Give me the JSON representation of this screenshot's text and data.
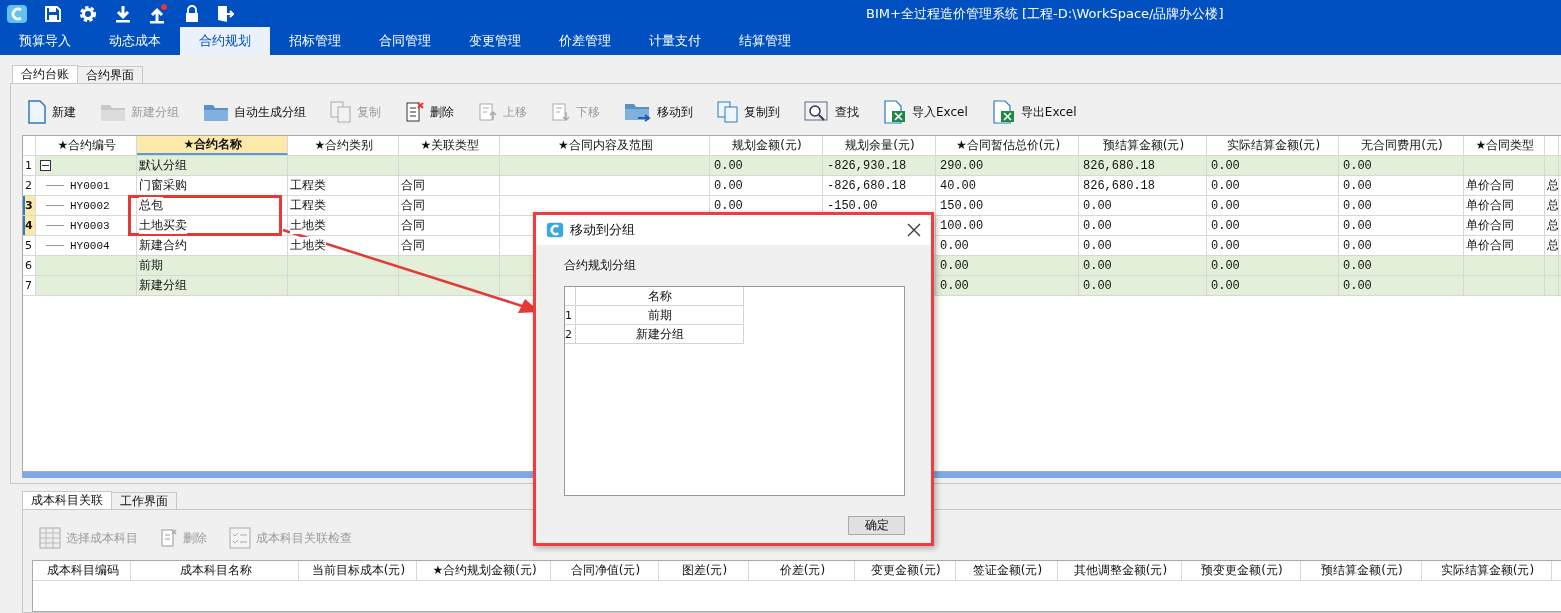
{
  "window": {
    "title": "BIM+全过程造价管理系统 [工程-D:\\WorkSpace/品牌办公楼]"
  },
  "menu_tabs": [
    {
      "label": "预算导入",
      "selected": false
    },
    {
      "label": "动态成本",
      "selected": false
    },
    {
      "label": "合约规划",
      "selected": true
    },
    {
      "label": "招标管理",
      "selected": false
    },
    {
      "label": "合同管理",
      "selected": false
    },
    {
      "label": "变更管理",
      "selected": false
    },
    {
      "label": "价差管理",
      "selected": false
    },
    {
      "label": "计量支付",
      "selected": false
    },
    {
      "label": "结算管理",
      "selected": false
    }
  ],
  "sub_tabs": [
    {
      "label": "合约台账",
      "selected": true
    },
    {
      "label": "合约界面",
      "selected": false
    }
  ],
  "toolbar": [
    {
      "label": "新建",
      "disabled": false
    },
    {
      "label": "新建分组",
      "disabled": true
    },
    {
      "label": "自动生成分组",
      "disabled": false
    },
    {
      "label": "复制",
      "disabled": true
    },
    {
      "label": "删除",
      "disabled": false
    },
    {
      "label": "上移",
      "disabled": true
    },
    {
      "label": "下移",
      "disabled": true
    },
    {
      "label": "移动到",
      "disabled": false
    },
    {
      "label": "复制到",
      "disabled": false
    },
    {
      "label": "查找",
      "disabled": false
    },
    {
      "label": "导入Excel",
      "disabled": false
    },
    {
      "label": "导出Excel",
      "disabled": false
    }
  ],
  "table": {
    "columns": [
      {
        "label": "★合约编号",
        "selected": false
      },
      {
        "label": "★合约名称",
        "selected": true
      },
      {
        "label": "★合约类别",
        "selected": false
      },
      {
        "label": "★关联类型",
        "selected": false
      },
      {
        "label": "★合同内容及范围",
        "selected": false
      },
      {
        "label": "规划金额(元)",
        "selected": false
      },
      {
        "label": "规划余量(元)",
        "selected": false
      },
      {
        "label": "★合同暂估总价(元)",
        "selected": false
      },
      {
        "label": "预结算金额(元)",
        "selected": false
      },
      {
        "label": "实际结算金额(元)",
        "selected": false
      },
      {
        "label": "无合同费用(元)",
        "selected": false
      },
      {
        "label": "★合同类型",
        "selected": false
      },
      {
        "selected": false
      }
    ],
    "rows": [
      {
        "number": "1",
        "kind": "group",
        "expanded": true,
        "selected": false,
        "cells": [
          null,
          "默认分组",
          null,
          null,
          null,
          "0.00",
          "-826,930.18",
          "290.00",
          "826,680.18",
          "0.00",
          "0.00",
          null,
          null
        ]
      },
      {
        "number": "2",
        "kind": "item",
        "selected": false,
        "cells": [
          "HY0001",
          "门窗采购",
          "工程类",
          "合同",
          null,
          "0.00",
          "-826,680.18",
          "40.00",
          "826,680.18",
          "0.00",
          "0.00",
          "单价合同",
          "总"
        ]
      },
      {
        "number": "3",
        "kind": "item",
        "selected": true,
        "cells": [
          "HY0002",
          "总包",
          "工程类",
          "合同",
          null,
          "0.00",
          "-150.00",
          "150.00",
          "0.00",
          "0.00",
          "0.00",
          "单价合同",
          "总"
        ]
      },
      {
        "number": "4",
        "kind": "item",
        "selected": true,
        "cells": [
          "HY0003",
          "土地买卖",
          "土地类",
          "合同",
          null,
          null,
          null,
          "100.00",
          "0.00",
          "0.00",
          "0.00",
          "单价合同",
          "总"
        ]
      },
      {
        "number": "5",
        "kind": "item",
        "selected": false,
        "cells": [
          "HY0004",
          "新建合约",
          "土地类",
          "合同",
          null,
          null,
          null,
          "0.00",
          "0.00",
          "0.00",
          "0.00",
          "单价合同",
          "总"
        ]
      },
      {
        "number": "6",
        "kind": "group",
        "selected": false,
        "cells": [
          null,
          "前期",
          null,
          null,
          null,
          null,
          null,
          "0.00",
          "0.00",
          "0.00",
          "0.00",
          null,
          null
        ]
      },
      {
        "number": "7",
        "kind": "group",
        "selected": false,
        "cells": [
          null,
          "新建分组",
          null,
          null,
          null,
          null,
          null,
          "0.00",
          "0.00",
          "0.00",
          "0.00",
          null,
          null
        ]
      }
    ]
  },
  "bottom_tabs": [
    {
      "label": "成本科目关联",
      "selected": true
    },
    {
      "label": "工作界面",
      "selected": false
    }
  ],
  "bottom_toolbar": [
    {
      "label": "选择成本科目",
      "disabled": true
    },
    {
      "label": "删除",
      "disabled": true
    },
    {
      "label": "成本科目关联检查",
      "disabled": true
    }
  ],
  "bottom_table": {
    "columns": [
      "成本科目编码",
      "成本科目名称",
      "当前目标成本(元)",
      "★合约规划金额(元)",
      "合同净值(元)",
      "图差(元)",
      "价差(元)",
      "变更金额(元)",
      "签证金额(元)",
      "其他调整金额(元)",
      "预变更金额(元)",
      "预结算金额(元)",
      "实际结算金额(元)"
    ]
  },
  "dialog": {
    "title": "移动到分组",
    "label": "合约规划分组",
    "column": "名称",
    "rows": [
      {
        "number": "1",
        "name": "前期"
      },
      {
        "number": "2",
        "name": "新建分组"
      }
    ],
    "button": "确定"
  }
}
